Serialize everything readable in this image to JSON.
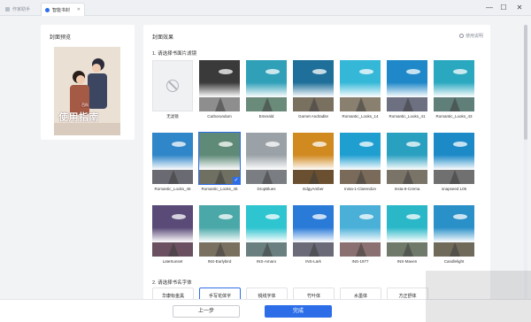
{
  "tabs": [
    {
      "label": "作家助手"
    },
    {
      "label": "智能书封"
    }
  ],
  "window_controls": {
    "minimize": "—",
    "maximize": "☐",
    "close": "✕"
  },
  "left_panel": {
    "title": "封面预览",
    "cover_title": "使用指南",
    "cover_subtitle": "百科"
  },
  "right_panel": {
    "title": "封面效果",
    "help_label": "使用说明",
    "section1_label": "1. 请选择书面片滤镜",
    "section2_label": "2. 请选择书名字体",
    "selected_filter": "Romantic_Looks_45",
    "filters": [
      {
        "name": "无滤镜",
        "sky": "#ffffff",
        "ground": "#ffffff"
      },
      {
        "name": "Carborundum",
        "sky": "#3a3a3a",
        "ground": "#8e8e8e"
      },
      {
        "name": "Emerald",
        "sky": "#2fa0b8",
        "ground": "#6a8a7a"
      },
      {
        "name": "Garnet Andradite",
        "sky": "#1e6f9a",
        "ground": "#7a7060"
      },
      {
        "name": "Romantic_Looks_14",
        "sky": "#35b8d8",
        "ground": "#8a8070"
      },
      {
        "name": "Romantic_Looks_41",
        "sky": "#1f88c8",
        "ground": "#6d7080"
      },
      {
        "name": "Romantic_Looks_43",
        "sky": "#2aa8c0",
        "ground": "#5f7f78"
      },
      {
        "name": "Romantic_Looks_46",
        "sky": "#2f86c8",
        "ground": "#6a6a72"
      },
      {
        "name": "Romantic_Looks_45",
        "sky": "#5f8a78",
        "ground": "#6f7062"
      },
      {
        "name": "DropBlues",
        "sky": "#9aa2a8",
        "ground": "#7a7e82"
      },
      {
        "name": "EdgyAmber",
        "sky": "#d08a20",
        "ground": "#6a5030"
      },
      {
        "name": "Insta-1-Clarendon",
        "sky": "#1f9ed0",
        "ground": "#7a6a5a"
      },
      {
        "name": "Insta-8-Crema",
        "sky": "#2aa0c0",
        "ground": "#7a7468"
      },
      {
        "name": "snapseed L05",
        "sky": "#1d8ac8",
        "ground": "#707070"
      },
      {
        "name": "LateSunset",
        "sky": "#5a4a78",
        "ground": "#6a5060"
      },
      {
        "name": "INS-Earlybird",
        "sky": "#4aa8a8",
        "ground": "#7a7060"
      },
      {
        "name": "INS-Amaro",
        "sky": "#2ec4d0",
        "ground": "#6a8080"
      },
      {
        "name": "INS-Lark",
        "sky": "#2a7ad8",
        "ground": "#6a6a78"
      },
      {
        "name": "INS-1977",
        "sky": "#4ab0d8",
        "ground": "#8a7070"
      },
      {
        "name": "INS-Maven",
        "sky": "#2ab8c8",
        "ground": "#6f7a6a"
      },
      {
        "name": "Candlelight",
        "sky": "#2a90c8",
        "ground": "#706a5a"
      }
    ],
    "fonts": [
      "华康标金黑",
      "手写花体字",
      "锐线字体",
      "竹叶体",
      "水墨体",
      "方正舒体"
    ]
  },
  "buttons": {
    "prev": "上一步",
    "done": "完成"
  }
}
